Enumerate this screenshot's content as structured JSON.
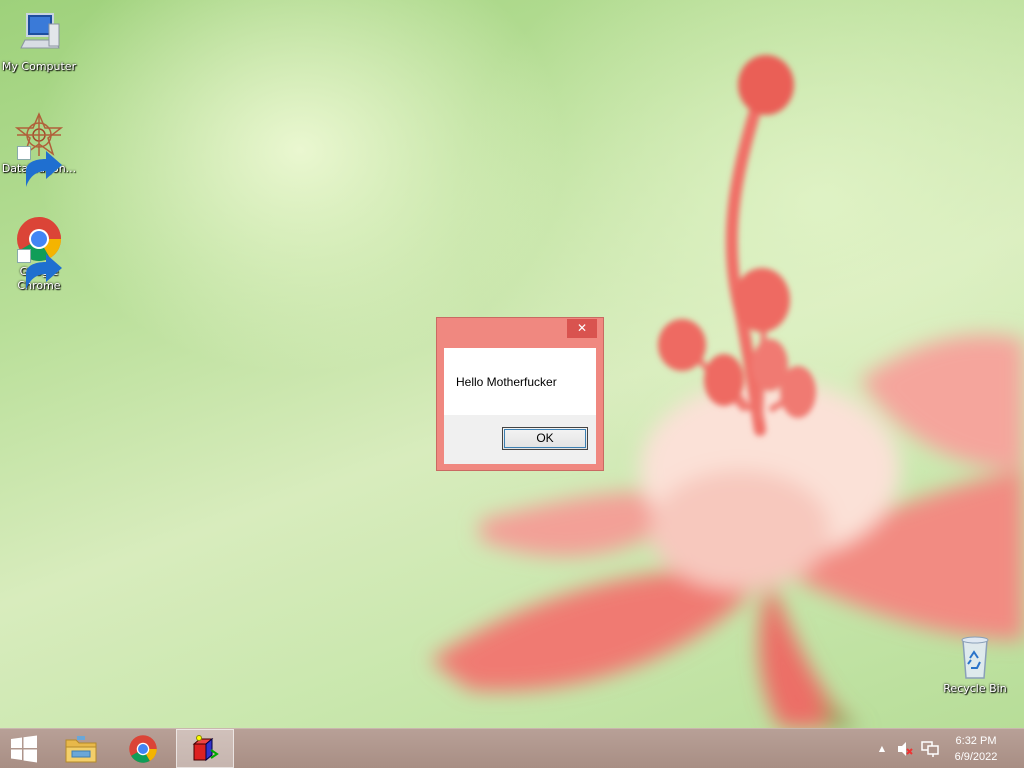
{
  "desktop": {
    "icons": [
      {
        "label": "My Computer",
        "icon": "computer-icon"
      },
      {
        "label": "DataWagon...",
        "icon": "datawagon-icon"
      },
      {
        "label": "Google Chrome",
        "icon": "chrome-icon"
      },
      {
        "label": "Recycle Bin",
        "icon": "recycle-bin-icon"
      }
    ]
  },
  "dialog": {
    "close_label": "✕",
    "message": "Hello Motherfucker",
    "ok_label": "OK"
  },
  "taskbar": {
    "start_icon": "windows-logo-icon",
    "pinned": [
      "file-explorer-icon",
      "chrome-icon",
      "app-icon"
    ],
    "tray": {
      "overflow_glyph": "▲",
      "volume_icon": "volume-muted-icon",
      "network_icon": "network-icon"
    },
    "clock": {
      "time": "6:32 PM",
      "date": "6/9/2022"
    }
  },
  "colors": {
    "dialog_frame": "#f08880",
    "dialog_close": "#d9534f",
    "taskbar": "#ac938a"
  }
}
